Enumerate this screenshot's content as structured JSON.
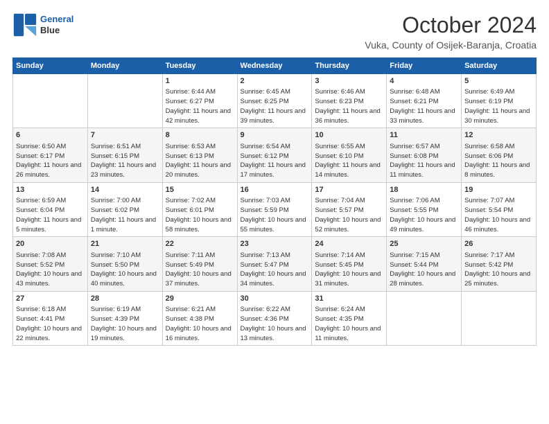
{
  "header": {
    "logo": {
      "line1": "General",
      "line2": "Blue"
    },
    "title": "October 2024",
    "location": "Vuka, County of Osijek-Baranja, Croatia"
  },
  "weekdays": [
    "Sunday",
    "Monday",
    "Tuesday",
    "Wednesday",
    "Thursday",
    "Friday",
    "Saturday"
  ],
  "weeks": [
    [
      {
        "day": "",
        "info": ""
      },
      {
        "day": "",
        "info": ""
      },
      {
        "day": "1",
        "info": "Sunrise: 6:44 AM\nSunset: 6:27 PM\nDaylight: 11 hours\nand 42 minutes."
      },
      {
        "day": "2",
        "info": "Sunrise: 6:45 AM\nSunset: 6:25 PM\nDaylight: 11 hours\nand 39 minutes."
      },
      {
        "day": "3",
        "info": "Sunrise: 6:46 AM\nSunset: 6:23 PM\nDaylight: 11 hours\nand 36 minutes."
      },
      {
        "day": "4",
        "info": "Sunrise: 6:48 AM\nSunset: 6:21 PM\nDaylight: 11 hours\nand 33 minutes."
      },
      {
        "day": "5",
        "info": "Sunrise: 6:49 AM\nSunset: 6:19 PM\nDaylight: 11 hours\nand 30 minutes."
      }
    ],
    [
      {
        "day": "6",
        "info": "Sunrise: 6:50 AM\nSunset: 6:17 PM\nDaylight: 11 hours\nand 26 minutes."
      },
      {
        "day": "7",
        "info": "Sunrise: 6:51 AM\nSunset: 6:15 PM\nDaylight: 11 hours\nand 23 minutes."
      },
      {
        "day": "8",
        "info": "Sunrise: 6:53 AM\nSunset: 6:13 PM\nDaylight: 11 hours\nand 20 minutes."
      },
      {
        "day": "9",
        "info": "Sunrise: 6:54 AM\nSunset: 6:12 PM\nDaylight: 11 hours\nand 17 minutes."
      },
      {
        "day": "10",
        "info": "Sunrise: 6:55 AM\nSunset: 6:10 PM\nDaylight: 11 hours\nand 14 minutes."
      },
      {
        "day": "11",
        "info": "Sunrise: 6:57 AM\nSunset: 6:08 PM\nDaylight: 11 hours\nand 11 minutes."
      },
      {
        "day": "12",
        "info": "Sunrise: 6:58 AM\nSunset: 6:06 PM\nDaylight: 11 hours\nand 8 minutes."
      }
    ],
    [
      {
        "day": "13",
        "info": "Sunrise: 6:59 AM\nSunset: 6:04 PM\nDaylight: 11 hours\nand 5 minutes."
      },
      {
        "day": "14",
        "info": "Sunrise: 7:00 AM\nSunset: 6:02 PM\nDaylight: 11 hours\nand 1 minute."
      },
      {
        "day": "15",
        "info": "Sunrise: 7:02 AM\nSunset: 6:01 PM\nDaylight: 10 hours\nand 58 minutes."
      },
      {
        "day": "16",
        "info": "Sunrise: 7:03 AM\nSunset: 5:59 PM\nDaylight: 10 hours\nand 55 minutes."
      },
      {
        "day": "17",
        "info": "Sunrise: 7:04 AM\nSunset: 5:57 PM\nDaylight: 10 hours\nand 52 minutes."
      },
      {
        "day": "18",
        "info": "Sunrise: 7:06 AM\nSunset: 5:55 PM\nDaylight: 10 hours\nand 49 minutes."
      },
      {
        "day": "19",
        "info": "Sunrise: 7:07 AM\nSunset: 5:54 PM\nDaylight: 10 hours\nand 46 minutes."
      }
    ],
    [
      {
        "day": "20",
        "info": "Sunrise: 7:08 AM\nSunset: 5:52 PM\nDaylight: 10 hours\nand 43 minutes."
      },
      {
        "day": "21",
        "info": "Sunrise: 7:10 AM\nSunset: 5:50 PM\nDaylight: 10 hours\nand 40 minutes."
      },
      {
        "day": "22",
        "info": "Sunrise: 7:11 AM\nSunset: 5:49 PM\nDaylight: 10 hours\nand 37 minutes."
      },
      {
        "day": "23",
        "info": "Sunrise: 7:13 AM\nSunset: 5:47 PM\nDaylight: 10 hours\nand 34 minutes."
      },
      {
        "day": "24",
        "info": "Sunrise: 7:14 AM\nSunset: 5:45 PM\nDaylight: 10 hours\nand 31 minutes."
      },
      {
        "day": "25",
        "info": "Sunrise: 7:15 AM\nSunset: 5:44 PM\nDaylight: 10 hours\nand 28 minutes."
      },
      {
        "day": "26",
        "info": "Sunrise: 7:17 AM\nSunset: 5:42 PM\nDaylight: 10 hours\nand 25 minutes."
      }
    ],
    [
      {
        "day": "27",
        "info": "Sunrise: 6:18 AM\nSunset: 4:41 PM\nDaylight: 10 hours\nand 22 minutes."
      },
      {
        "day": "28",
        "info": "Sunrise: 6:19 AM\nSunset: 4:39 PM\nDaylight: 10 hours\nand 19 minutes."
      },
      {
        "day": "29",
        "info": "Sunrise: 6:21 AM\nSunset: 4:38 PM\nDaylight: 10 hours\nand 16 minutes."
      },
      {
        "day": "30",
        "info": "Sunrise: 6:22 AM\nSunset: 4:36 PM\nDaylight: 10 hours\nand 13 minutes."
      },
      {
        "day": "31",
        "info": "Sunrise: 6:24 AM\nSunset: 4:35 PM\nDaylight: 10 hours\nand 11 minutes."
      },
      {
        "day": "",
        "info": ""
      },
      {
        "day": "",
        "info": ""
      }
    ]
  ]
}
